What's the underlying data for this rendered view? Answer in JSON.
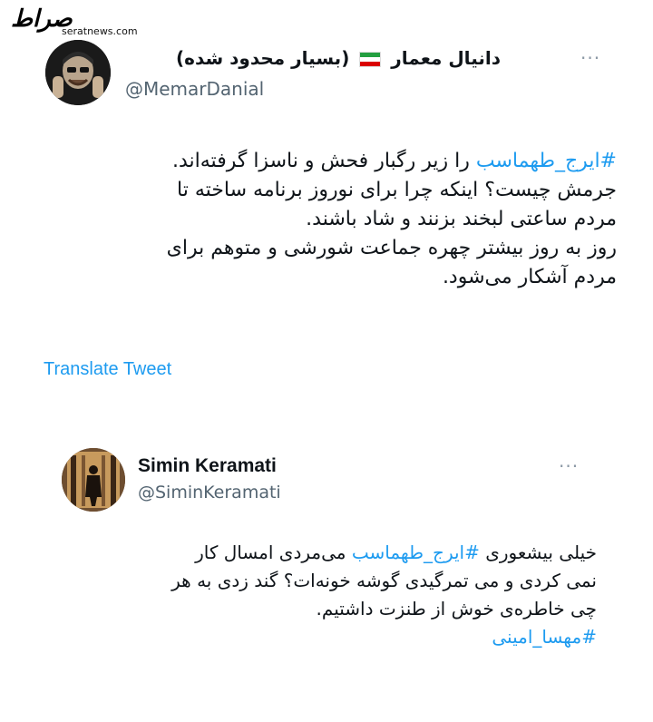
{
  "watermark": {
    "logo": "صراط",
    "url": "seratnews.com"
  },
  "tweet1": {
    "display_name": "دانیال معمار",
    "name_suffix": "(بسیار محدود شده)",
    "handle": "@MemarDanial",
    "more": "···",
    "flag_icon": "iran-flag-icon",
    "body": {
      "line1_hashtag": "#ایرج_طهماسب",
      "line1_rest": " را زیر رگبار فحش و ناسزا گرفته‌اند.",
      "line2": "جرمش چیست؟ اینکه چرا برای نوروز برنامه ساخته تا",
      "line3": "مردم ساعتی لبخند بزنند و شاد باشند.",
      "line4": "روز به روز بیشتر چهره جماعت شورشی و متوهم برای",
      "line5": "مردم آشکار می‌شود."
    },
    "translate": "Translate Tweet"
  },
  "tweet2": {
    "display_name": "Simin Keramati",
    "handle": "@SiminKeramati",
    "more": "···",
    "body": {
      "line1_start": "خیلی بیشعوری ",
      "line1_hashtag": "#ایرج_طهماسب",
      "line1_end": "  می‌مردی امسال کار",
      "line2": "نمی کردی و می تمرگیدی گوشه خونه‌ات؟ گند زدی به هر",
      "line3": "چی خاطره‌ی خوش از طنزت داشتیم.",
      "line4_hashtag": "#مهسا_امینی"
    }
  },
  "colors": {
    "link": "#1d9bf0",
    "muted": "#536471",
    "text": "#0f1419"
  }
}
